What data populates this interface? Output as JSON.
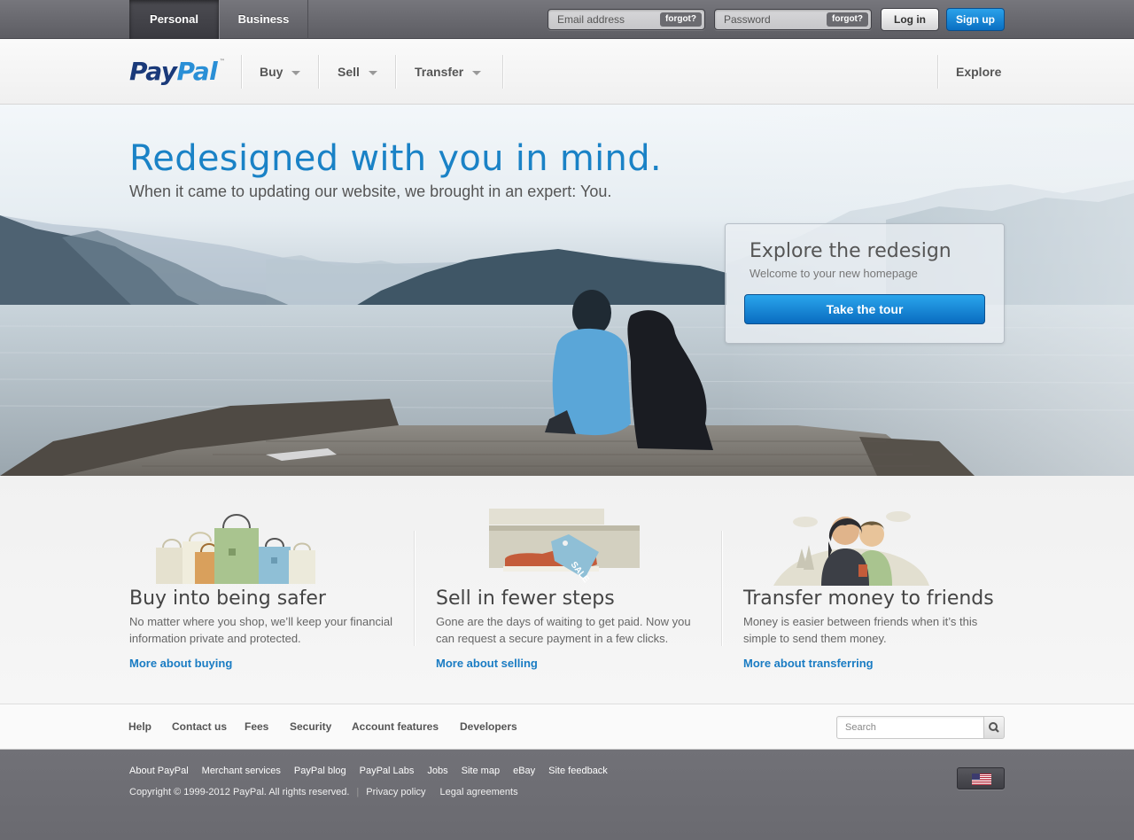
{
  "top_bar": {
    "tabs": {
      "personal": "Personal",
      "business": "Business"
    },
    "email_placeholder": "Email address",
    "password_placeholder": "Password",
    "forgot_label": "forgot?",
    "login_label": "Log in",
    "signup_label": "Sign up"
  },
  "nav": {
    "logo": {
      "pay": "Pay",
      "pal": "Pal",
      "tm": "™"
    },
    "items": {
      "buy": "Buy",
      "sell": "Sell",
      "transfer": "Transfer"
    },
    "explore": "Explore"
  },
  "hero": {
    "title": "Redesigned with you in mind.",
    "subtitle": "When it came to updating our website, we brought in an expert: You.",
    "explore_box": {
      "title": "Explore the redesign",
      "subtitle": "Welcome to your new homepage",
      "button": "Take the tour"
    }
  },
  "features": [
    {
      "title": "Buy into being safer",
      "text": "No matter where you shop, we’ll keep your financial information private and protected.",
      "link": "More about buying"
    },
    {
      "title": "Sell in fewer steps",
      "text": "Gone are the days of waiting to get paid. Now you can request a secure payment in a few clicks.",
      "link": "More about selling",
      "tag": "SALE"
    },
    {
      "title": "Transfer money to friends",
      "text": "Money is easier between friends when it’s this simple to send them money.",
      "link": "More about transferring"
    }
  ],
  "links_bar": {
    "items": [
      "Help",
      "Contact us",
      "Fees",
      "Security",
      "Account features",
      "Developers"
    ],
    "search_placeholder": "Search"
  },
  "footer": {
    "links": [
      "About PayPal",
      "Merchant services",
      "PayPal blog",
      "PayPal Labs",
      "Jobs",
      "Site map",
      "eBay",
      "Site feedback"
    ],
    "copyright": "Copyright © 1999-2012 PayPal. All rights reserved.",
    "separator": "|",
    "legal_links": [
      "Privacy policy",
      "Legal agreements"
    ]
  },
  "colors": {
    "brand_blue": "#1a82c6",
    "button_blue": "#0a6fc2",
    "topbar_gray": "#666670"
  }
}
